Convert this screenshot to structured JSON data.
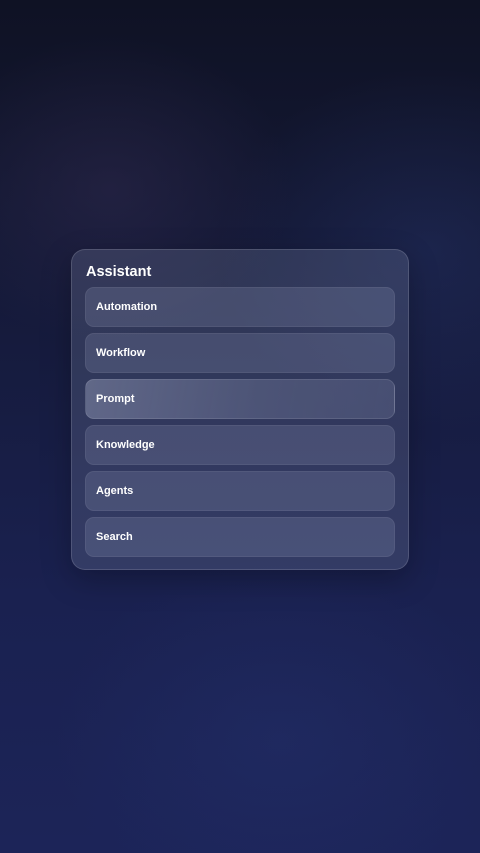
{
  "panel": {
    "title": "Assistant",
    "items": [
      {
        "label": "Automation"
      },
      {
        "label": "Workflow"
      },
      {
        "label": "Prompt"
      },
      {
        "label": "Knowledge"
      },
      {
        "label": "Agents"
      },
      {
        "label": "Search"
      }
    ]
  }
}
